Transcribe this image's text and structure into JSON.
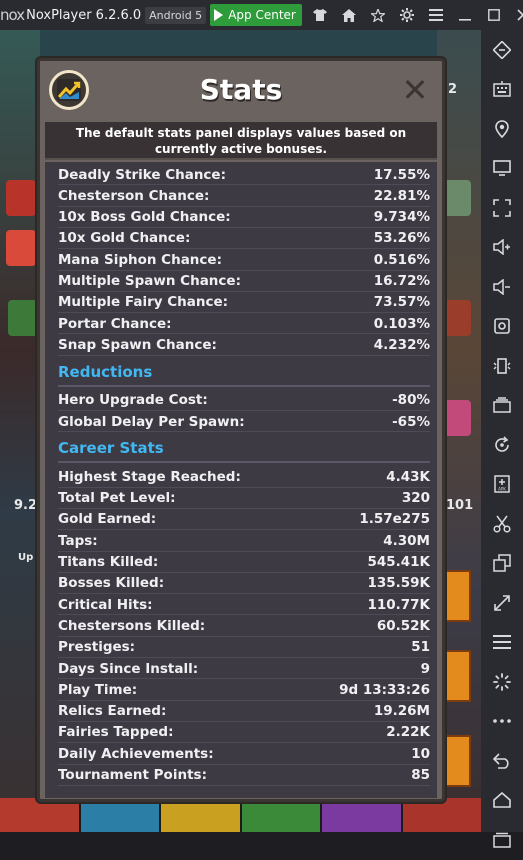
{
  "titlebar": {
    "logo": "nox",
    "app_title": "NoxPlayer 6.2.6.0",
    "android_badge": "Android 5",
    "app_center": "App Center",
    "icons": [
      "shirt-icon",
      "home-icon",
      "star-icon",
      "gear-icon",
      "menu-icon",
      "minimize-icon",
      "maximize-icon",
      "close-icon"
    ]
  },
  "sidebar": {
    "icons": [
      "resize-icon",
      "keyboard-icon",
      "location-icon",
      "screen-icon",
      "fullscreen-icon",
      "volume-up-icon",
      "volume-down-icon",
      "screenshot-icon",
      "shake-icon",
      "multi-instance-icon",
      "sync-icon",
      "apk-icon",
      "scissors-icon",
      "copy-icon",
      "expand-icon",
      "menu-icon",
      "loading-icon",
      "more-icon",
      "back-icon",
      "home-icon",
      "recent-apps-icon"
    ]
  },
  "game": {
    "left_number": "9.2",
    "right_number": "101",
    "upgrade_label": "Up",
    "badge_number": "2",
    "badge_number_right": "2"
  },
  "modal": {
    "title": "Stats",
    "close_symbol": "✕",
    "notice": "The default stats panel displays values based on currently active bonuses.",
    "bonus_stats": [
      {
        "label": "Deadly Strike Chance:",
        "value": "17.55%"
      },
      {
        "label": "Chesterson Chance:",
        "value": "22.81%"
      },
      {
        "label": "10x Boss Gold Chance:",
        "value": "9.734%"
      },
      {
        "label": "10x Gold Chance:",
        "value": "53.26%"
      },
      {
        "label": "Mana Siphon Chance:",
        "value": "0.516%"
      },
      {
        "label": "Multiple Spawn Chance:",
        "value": "16.72%"
      },
      {
        "label": "Multiple Fairy Chance:",
        "value": "73.57%"
      },
      {
        "label": "Portar Chance:",
        "value": "0.103%"
      },
      {
        "label": "Snap Spawn Chance:",
        "value": "4.232%"
      }
    ],
    "reductions_title": "Reductions",
    "reductions": [
      {
        "label": "Hero Upgrade Cost:",
        "value": "-80%"
      },
      {
        "label": "Global Delay Per Spawn:",
        "value": "-65%"
      }
    ],
    "career_title": "Career Stats",
    "career": [
      {
        "label": "Highest Stage Reached:",
        "value": "4.43K"
      },
      {
        "label": "Total Pet Level:",
        "value": "320"
      },
      {
        "label": "Gold Earned:",
        "value": "1.57e275"
      },
      {
        "label": "Taps:",
        "value": "4.30M"
      },
      {
        "label": "Titans Killed:",
        "value": "545.41K"
      },
      {
        "label": "Bosses Killed:",
        "value": "135.59K"
      },
      {
        "label": "Critical Hits:",
        "value": "110.77K"
      },
      {
        "label": "Chestersons Killed:",
        "value": "60.52K"
      },
      {
        "label": "Prestiges:",
        "value": "51"
      },
      {
        "label": "Days Since Install:",
        "value": "9"
      },
      {
        "label": "Play Time:",
        "value": "9d 13:33:26"
      },
      {
        "label": "Relics Earned:",
        "value": "19.26M"
      },
      {
        "label": "Fairies Tapped:",
        "value": "2.22K"
      },
      {
        "label": "Daily Achievements:",
        "value": "10"
      },
      {
        "label": "Tournament Points:",
        "value": "85"
      }
    ]
  },
  "colors": {
    "section_heading": "#41b8f2",
    "modal_frame": "#6a6360",
    "panel_bg": "#3d3a44",
    "app_center_green": "#2f9c3c"
  }
}
